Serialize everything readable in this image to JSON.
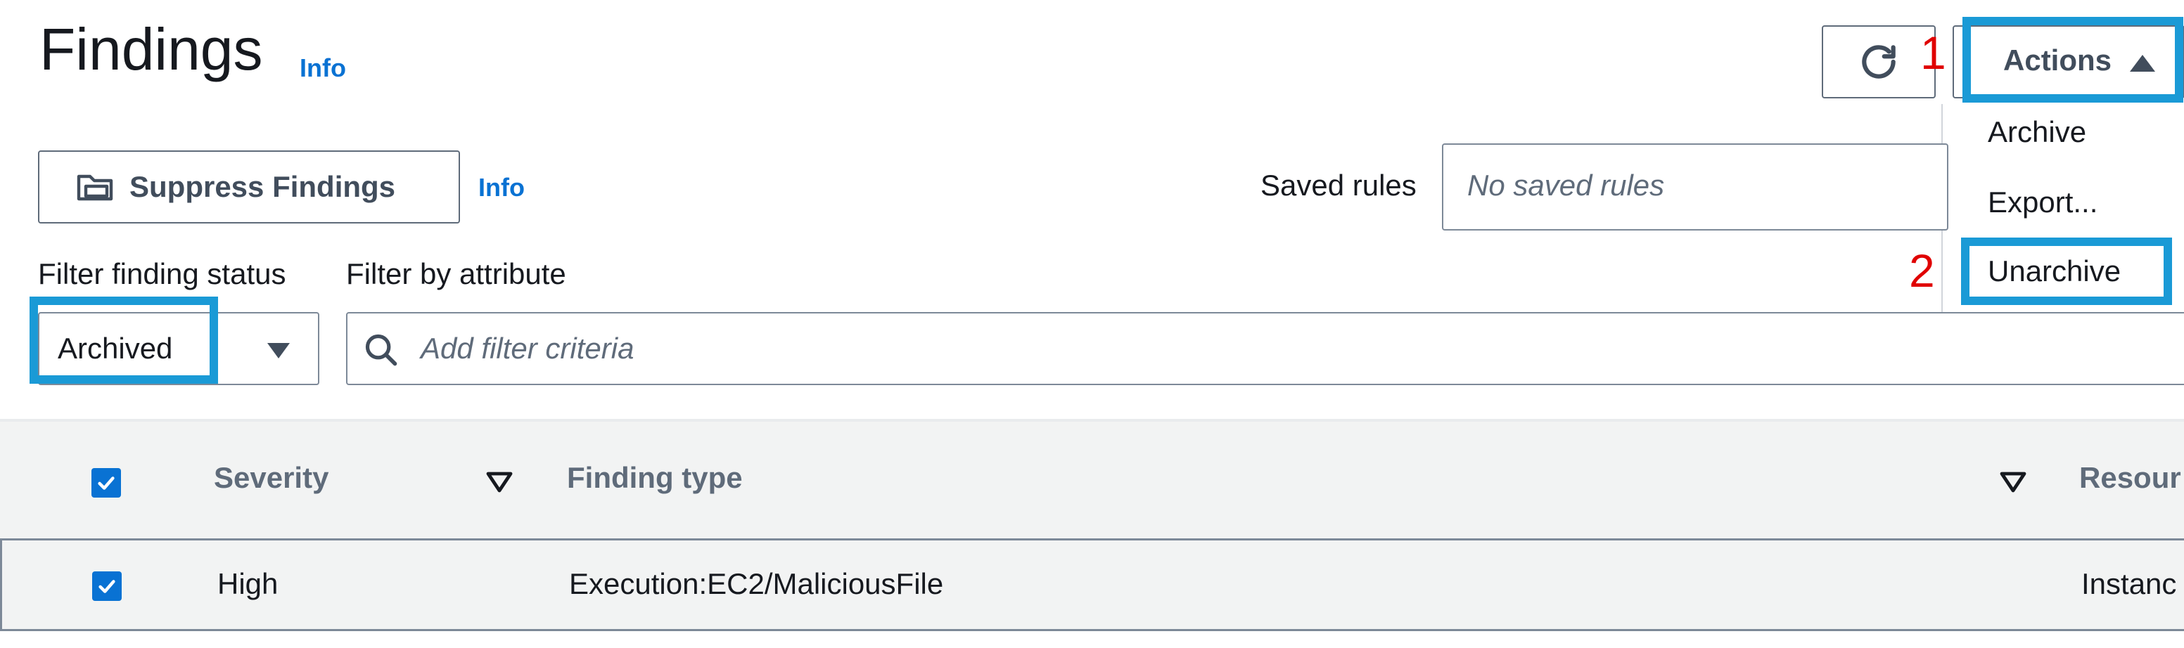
{
  "header": {
    "title": "Findings",
    "info_label": "Info",
    "refresh_icon": "refresh-icon",
    "actions_label": "Actions",
    "actions_caret_icon": "caret-up-icon"
  },
  "actions_menu": {
    "items": [
      "Archive",
      "Export...",
      "Unarchive"
    ]
  },
  "annotations": {
    "step1": "1",
    "step2": "2",
    "highlight_color": "#1a9ad6",
    "step_color": "#e00000"
  },
  "toolbar": {
    "suppress_label": "Suppress Findings",
    "suppress_icon": "folder-icon",
    "suppress_info": "Info",
    "saved_rules_label": "Saved rules",
    "saved_rules_placeholder": "No saved rules"
  },
  "filters": {
    "status_label": "Filter finding status",
    "status_value": "Archived",
    "attribute_label": "Filter by attribute",
    "attribute_placeholder": "Add filter criteria",
    "search_icon": "search-icon"
  },
  "table": {
    "columns": [
      "Severity",
      "Finding type",
      "Resour"
    ],
    "rows": [
      {
        "checked": true,
        "severity": "High",
        "finding_type": "Execution:EC2/MaliciousFile",
        "resource": "Instanc"
      }
    ]
  },
  "colors": {
    "link": "#0972d3",
    "checkbox": "#0972d3",
    "text": "#16191f"
  }
}
